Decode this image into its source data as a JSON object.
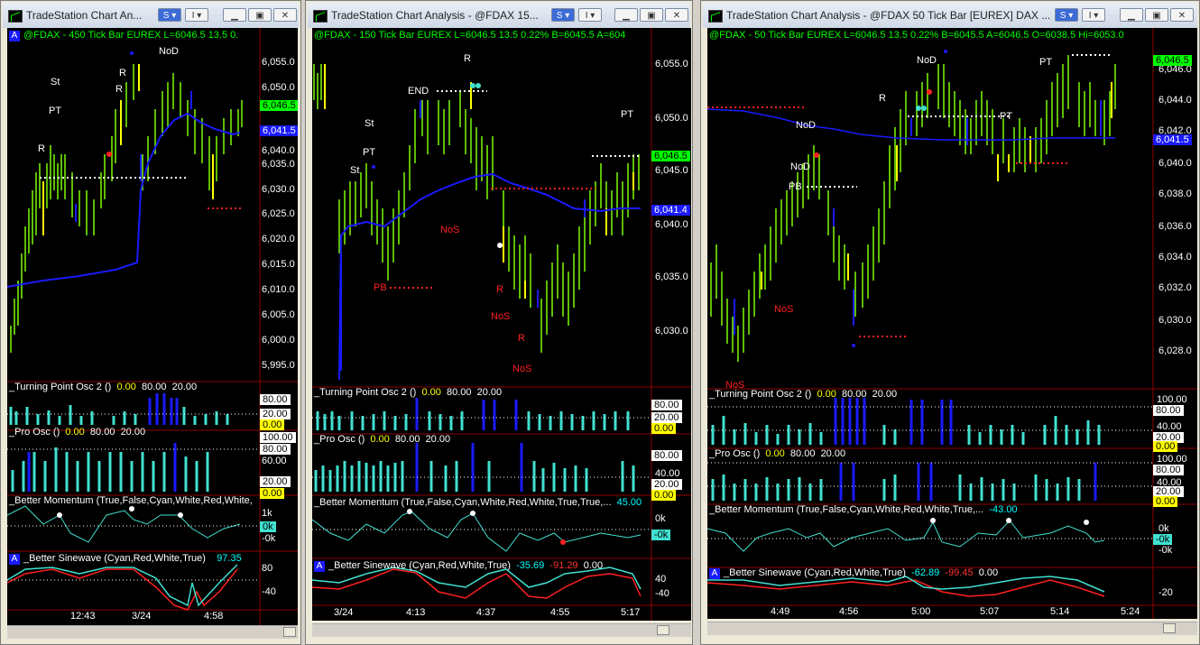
{
  "windows": [
    {
      "title": "TradeStation Chart An...",
      "s_btn": "S ▾",
      "i_btn": "I ▾",
      "header": "@FDAX - 450 Tick Bar  EUREX  L=6046.5  13.5  0.",
      "a_badge": "A",
      "yaxis": [
        "6,055.0",
        "6,050.0",
        "6,045.0",
        "6,040.0",
        "6,035.0",
        "6,030.0",
        "6,025.0",
        "6,020.0",
        "6,015.0",
        "6,010.0",
        "6,005.0",
        "6,000.0",
        "5,995.0"
      ],
      "last_tag": "6,046.5",
      "avg_tag": "6,041.5",
      "annotations": [
        "NoD",
        "R",
        "R",
        "St",
        "PT",
        "R"
      ],
      "ind1": {
        "name": "_Turning Point Osc 2 ()",
        "v1": "0.00",
        "v2": "80.00",
        "v3": "20.00",
        "axis": [
          "80.00",
          "20.00",
          "0.00"
        ]
      },
      "ind2": {
        "name": "_Pro Osc ()",
        "v1": "0.00",
        "v2": "80.00",
        "v3": "20.00",
        "axis": [
          "100.00",
          "80.00",
          "60.00",
          "20.00",
          "0.00"
        ]
      },
      "ind3": {
        "name": "_Better Momentum (True,False,Cyan,White,Red,White,",
        "v1": "",
        "axis": [
          "1k",
          "0k",
          "-0k"
        ]
      },
      "ind4": {
        "name": "_Better Sinewave (Cyan,Red,White,True)",
        "v1": "97.35",
        "v2": "",
        "v3": "",
        "axis": [
          "80",
          "-40"
        ]
      },
      "xaxis": [
        "12:43",
        "3/24",
        "4:58"
      ]
    },
    {
      "title": "TradeStation Chart Analysis - @FDAX 15...",
      "s_btn": "S ▾",
      "i_btn": "I ▾",
      "header": "@FDAX - 150 Tick Bar  EUREX  L=6046.5  13.5  0.22%       B=6045.5  A=604",
      "a_badge": "",
      "yaxis": [
        "6,055.0",
        "6,050.0",
        "6,045.0",
        "6,040.0",
        "6,035.0",
        "6,030.0"
      ],
      "last_tag": "6,046.5",
      "avg_tag": "6,041.4",
      "annotations": [
        "R",
        "END",
        "St",
        "PT",
        "St",
        "PT",
        "NoS",
        "PB",
        "R",
        "NoS",
        "R",
        "NoS"
      ],
      "ind1": {
        "name": "_Turning Point Osc 2 ()",
        "v1": "0.00",
        "v2": "80.00",
        "v3": "20.00",
        "axis": [
          "80.00",
          "20.00",
          "0.00"
        ]
      },
      "ind2": {
        "name": "_Pro Osc ()",
        "v1": "0.00",
        "v2": "80.00",
        "v3": "20.00",
        "axis": [
          "80.00",
          "40.00",
          "20.00",
          "0.00"
        ]
      },
      "ind3": {
        "name": "_Better Momentum (True,False,Cyan,White,Red,White,True,True,...",
        "v1": "45.00",
        "axis": [
          "0k",
          "-0k"
        ]
      },
      "ind4": {
        "name": "_Better Sinewave (Cyan,Red,White,True)",
        "v1": "-35.69",
        "v2": "-91.29",
        "v3": "0.00",
        "axis": [
          "40",
          "-40"
        ]
      },
      "xaxis": [
        "3/24",
        "4:13",
        "4:37",
        "4:55",
        "5:17"
      ]
    },
    {
      "title": "TradeStation Chart Analysis - @FDAX 50 Tick Bar [EUREX] DAX ...",
      "s_btn": "S ▾",
      "i_btn": "I ▾",
      "header": "@FDAX - 50 Tick Bar  EUREX  L=6046.5  13.5  0.22%       B=6045.5  A=6046.5  O=6038.5  Hi=6053.0",
      "a_badge": "",
      "yaxis": [
        "6,046.0",
        "6,044.0",
        "6,042.0",
        "6,040.0",
        "6,038.0",
        "6,036.0",
        "6,034.0",
        "6,032.0",
        "6,030.0",
        "6,028.0"
      ],
      "last_tag": "6,046.5",
      "avg_tag": "6,041.5",
      "annotations": [
        "NoD",
        "PT",
        "R",
        "PT",
        "NoD",
        "NoD",
        "PB",
        "NoS",
        "NoS"
      ],
      "ind1": {
        "name": "_Turning Point Osc 2 ()",
        "v1": "0.00",
        "v2": "80.00",
        "v3": "20.00",
        "axis": [
          "100.00",
          "80.00",
          "40.00",
          "20.00",
          "0.00"
        ]
      },
      "ind2": {
        "name": "_Pro Osc ()",
        "v1": "0.00",
        "v2": "80.00",
        "v3": "20.00",
        "axis": [
          "100.00",
          "80.00",
          "40.00",
          "20.00",
          "0.00"
        ]
      },
      "ind3": {
        "name": "_Better Momentum (True,False,Cyan,White,Red,White,True,...",
        "v1": "-43.00",
        "axis": [
          "0k",
          "-0k",
          "-0k"
        ]
      },
      "ind4": {
        "name": "_Better Sinewave (Cyan,Red,White,True)",
        "v1": "-62.89",
        "v2": "-99.45",
        "v3": "0.00",
        "axis": [
          "-20"
        ]
      },
      "xaxis": [
        "4:49",
        "4:56",
        "5:00",
        "5:07",
        "5:14",
        "5:24"
      ]
    }
  ],
  "colors": {
    "bar": "#7cfc00",
    "yellow": "#ffff00",
    "blue": "#1a1aff",
    "cyan": "#40e0d0",
    "red": "#ff2020",
    "white": "#ffffff"
  }
}
